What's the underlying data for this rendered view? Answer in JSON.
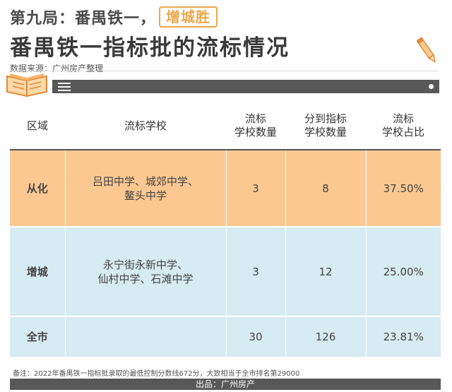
{
  "header": {
    "title_prefix": "第九局：番禺铁一，",
    "title_highlight": "增城胜",
    "title_main": "番禺铁一指标批的流标情况",
    "source": "数据来源：广州房产整理"
  },
  "table": {
    "columns": [
      {
        "lines": [
          "区域"
        ]
      },
      {
        "lines": [
          "流标学校"
        ]
      },
      {
        "lines": [
          "流标",
          "学校数量"
        ]
      },
      {
        "lines": [
          "分到指标",
          "学校数量"
        ]
      },
      {
        "lines": [
          "流标",
          "学校占比"
        ]
      }
    ],
    "rows": [
      {
        "region": "从化",
        "schools": [
          "吕田中学、城郊中学、",
          "鳌头中学"
        ],
        "failed_count": "3",
        "assigned_count": "8",
        "ratio": "37.50%"
      },
      {
        "region": "增城",
        "schools": [
          "永宁街永新中学、",
          "仙村中学、石滩中学"
        ],
        "failed_count": "3",
        "assigned_count": "12",
        "ratio": "25.00%"
      },
      {
        "region": "全市",
        "schools": [
          "",
          ""
        ],
        "failed_count": "30",
        "assigned_count": "126",
        "ratio": "23.81%"
      }
    ]
  },
  "footnote": "备注：2022年番禺铁一指标批录取的最低控制分数线672分，大致相当于全市排名第29000",
  "footer": "出品：广州房产",
  "colors": {
    "accent": "#f0a64b",
    "orange_row": "#fcc891",
    "blue_row": "#d6ebf2",
    "bar": "#585858"
  },
  "icons": [
    "pencil-icon",
    "book-icon",
    "menu-icon",
    "dot-icon"
  ]
}
